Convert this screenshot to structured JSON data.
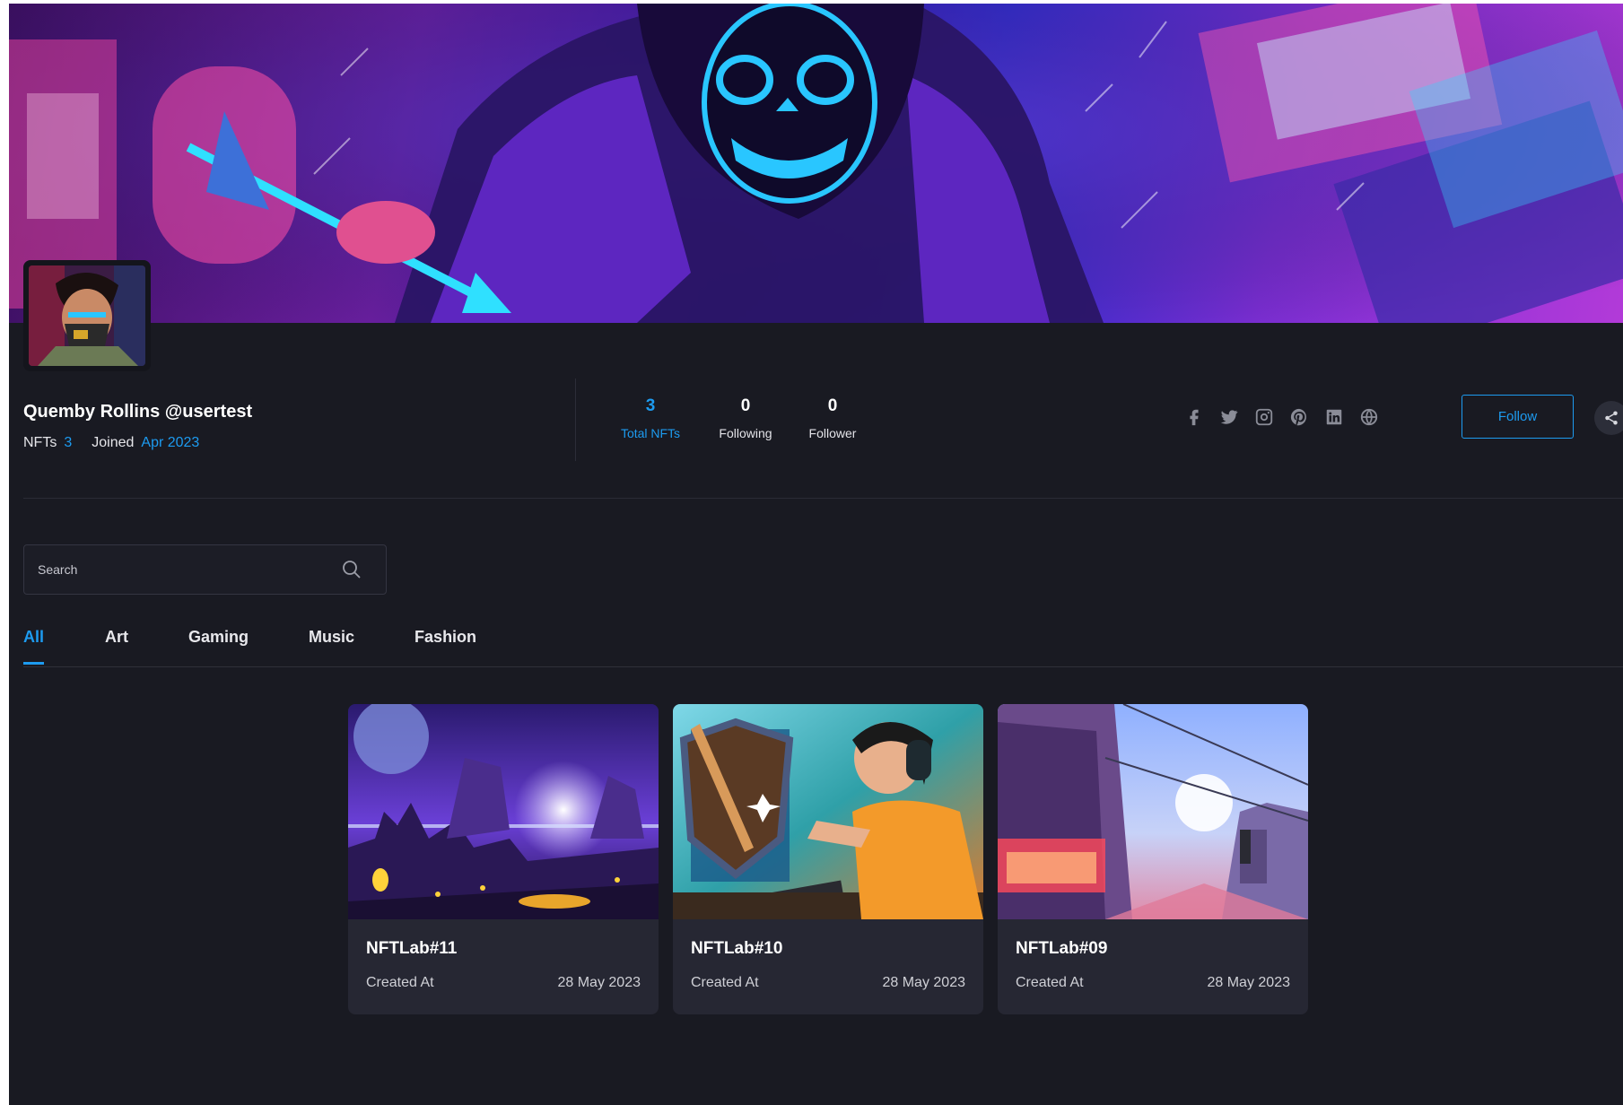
{
  "profile": {
    "display_name": "Quemby Rollins @usertest",
    "nfts_label": "NFTs",
    "nfts_count": "3",
    "joined_label": "Joined",
    "joined_date": "Apr 2023"
  },
  "stats": [
    {
      "value": "3",
      "label": "Total NFTs"
    },
    {
      "value": "0",
      "label": "Following"
    },
    {
      "value": "0",
      "label": "Follower"
    }
  ],
  "socials": [
    "facebook-icon",
    "twitter-icon",
    "instagram-icon",
    "pinterest-icon",
    "linkedin-icon",
    "globe-icon"
  ],
  "actions": {
    "follow_label": "Follow",
    "share_icon": "share-icon"
  },
  "search": {
    "placeholder": "Search"
  },
  "tabs": [
    {
      "label": "All"
    },
    {
      "label": "Art"
    },
    {
      "label": "Gaming"
    },
    {
      "label": "Music"
    },
    {
      "label": "Fashion"
    }
  ],
  "cards": [
    {
      "title": "NFTLab#11",
      "created_label": "Created At",
      "date": "28 May 2023"
    },
    {
      "title": "NFTLab#10",
      "created_label": "Created At",
      "date": "28 May 2023"
    },
    {
      "title": "NFTLab#09",
      "created_label": "Created At",
      "date": "28 May 2023"
    }
  ],
  "colors": {
    "accent": "#1d9bf0",
    "background": "#191a22",
    "card": "#262733"
  }
}
